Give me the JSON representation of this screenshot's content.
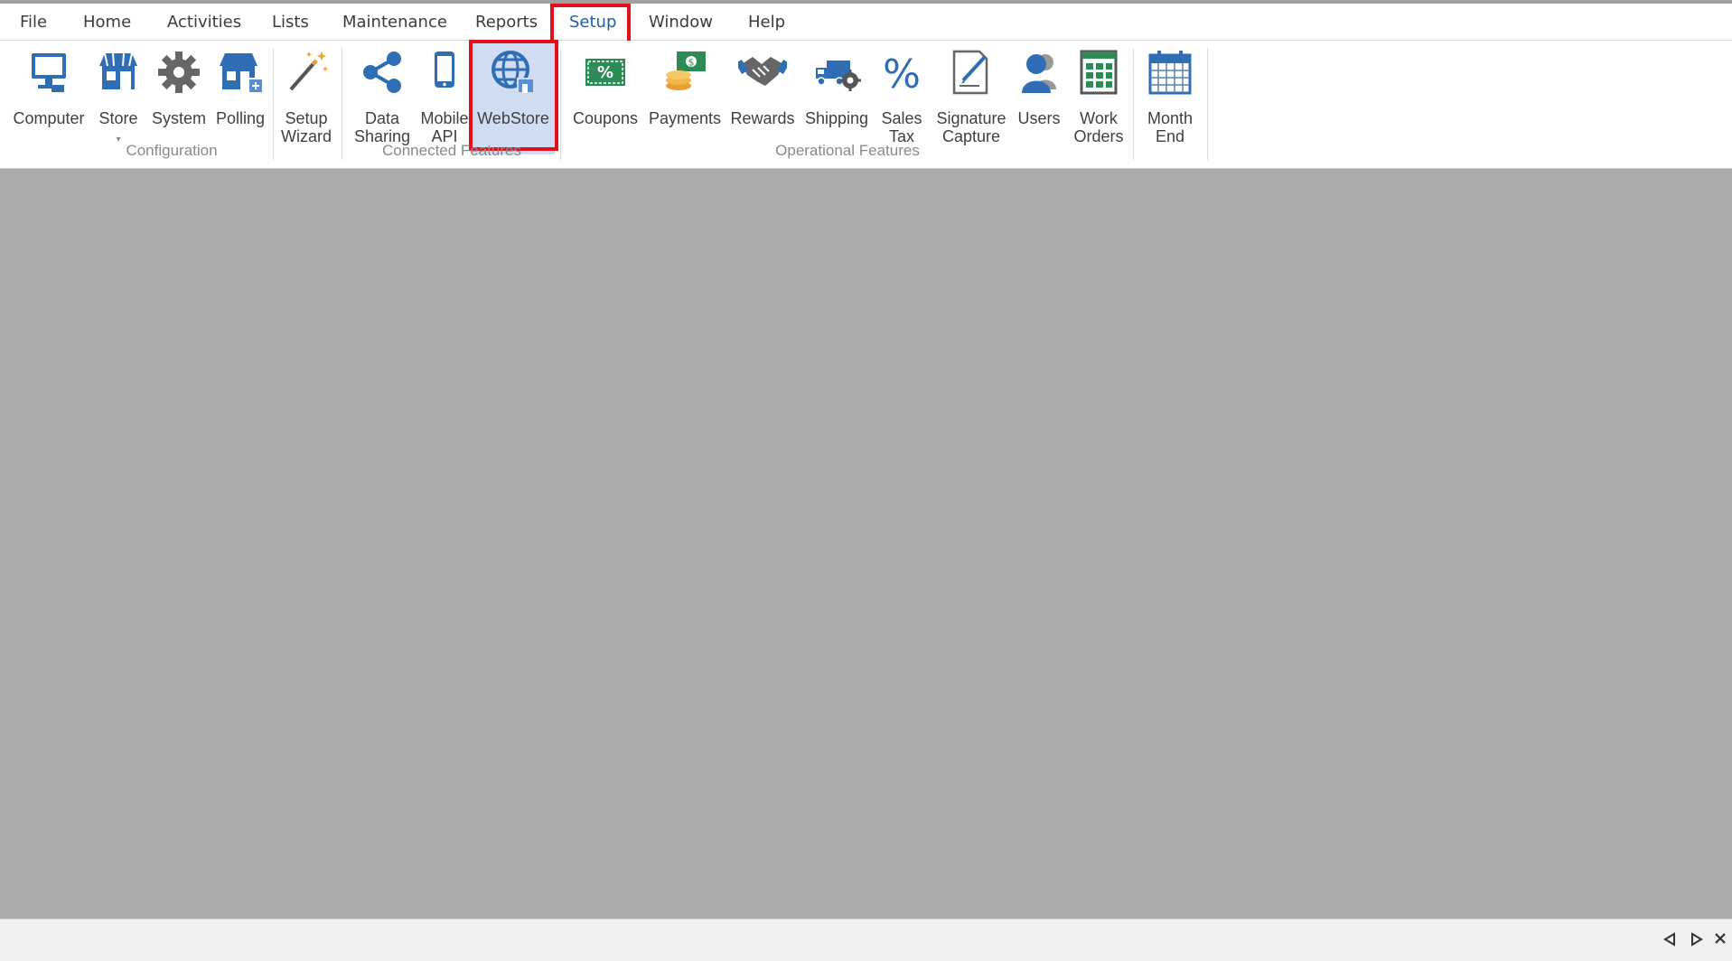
{
  "menu": {
    "items": [
      "File",
      "Home",
      "Activities",
      "Lists",
      "Maintenance",
      "Reports",
      "Setup",
      "Window",
      "Help"
    ],
    "active": "Setup"
  },
  "ribbon": {
    "configuration": {
      "label": "Configuration",
      "computer": "Computer",
      "store": "Store",
      "system": "System",
      "polling": "Polling",
      "setup_wizard": "Setup\nWizard"
    },
    "connected": {
      "label": "Connected Features",
      "data_sharing": "Data\nSharing",
      "mobile_api": "Mobile\nAPI",
      "webstore": "WebStore"
    },
    "operational": {
      "label": "Operational Features",
      "coupons": "Coupons",
      "payments": "Payments",
      "rewards": "Rewards",
      "shipping": "Shipping",
      "sales_tax": "Sales\nTax",
      "signature_capture": "Signature\nCapture",
      "users": "Users",
      "work_orders": "Work\nOrders"
    },
    "month_end": "Month\nEnd"
  },
  "colors": {
    "accent_blue": "#2f6db5",
    "highlight_red": "#e0101c",
    "selected_bg": "#cfdcf2",
    "workspace_gray": "#ababab"
  },
  "statusbar": {
    "icons": [
      "prev-arrow-icon",
      "next-arrow-icon",
      "close-icon"
    ]
  }
}
